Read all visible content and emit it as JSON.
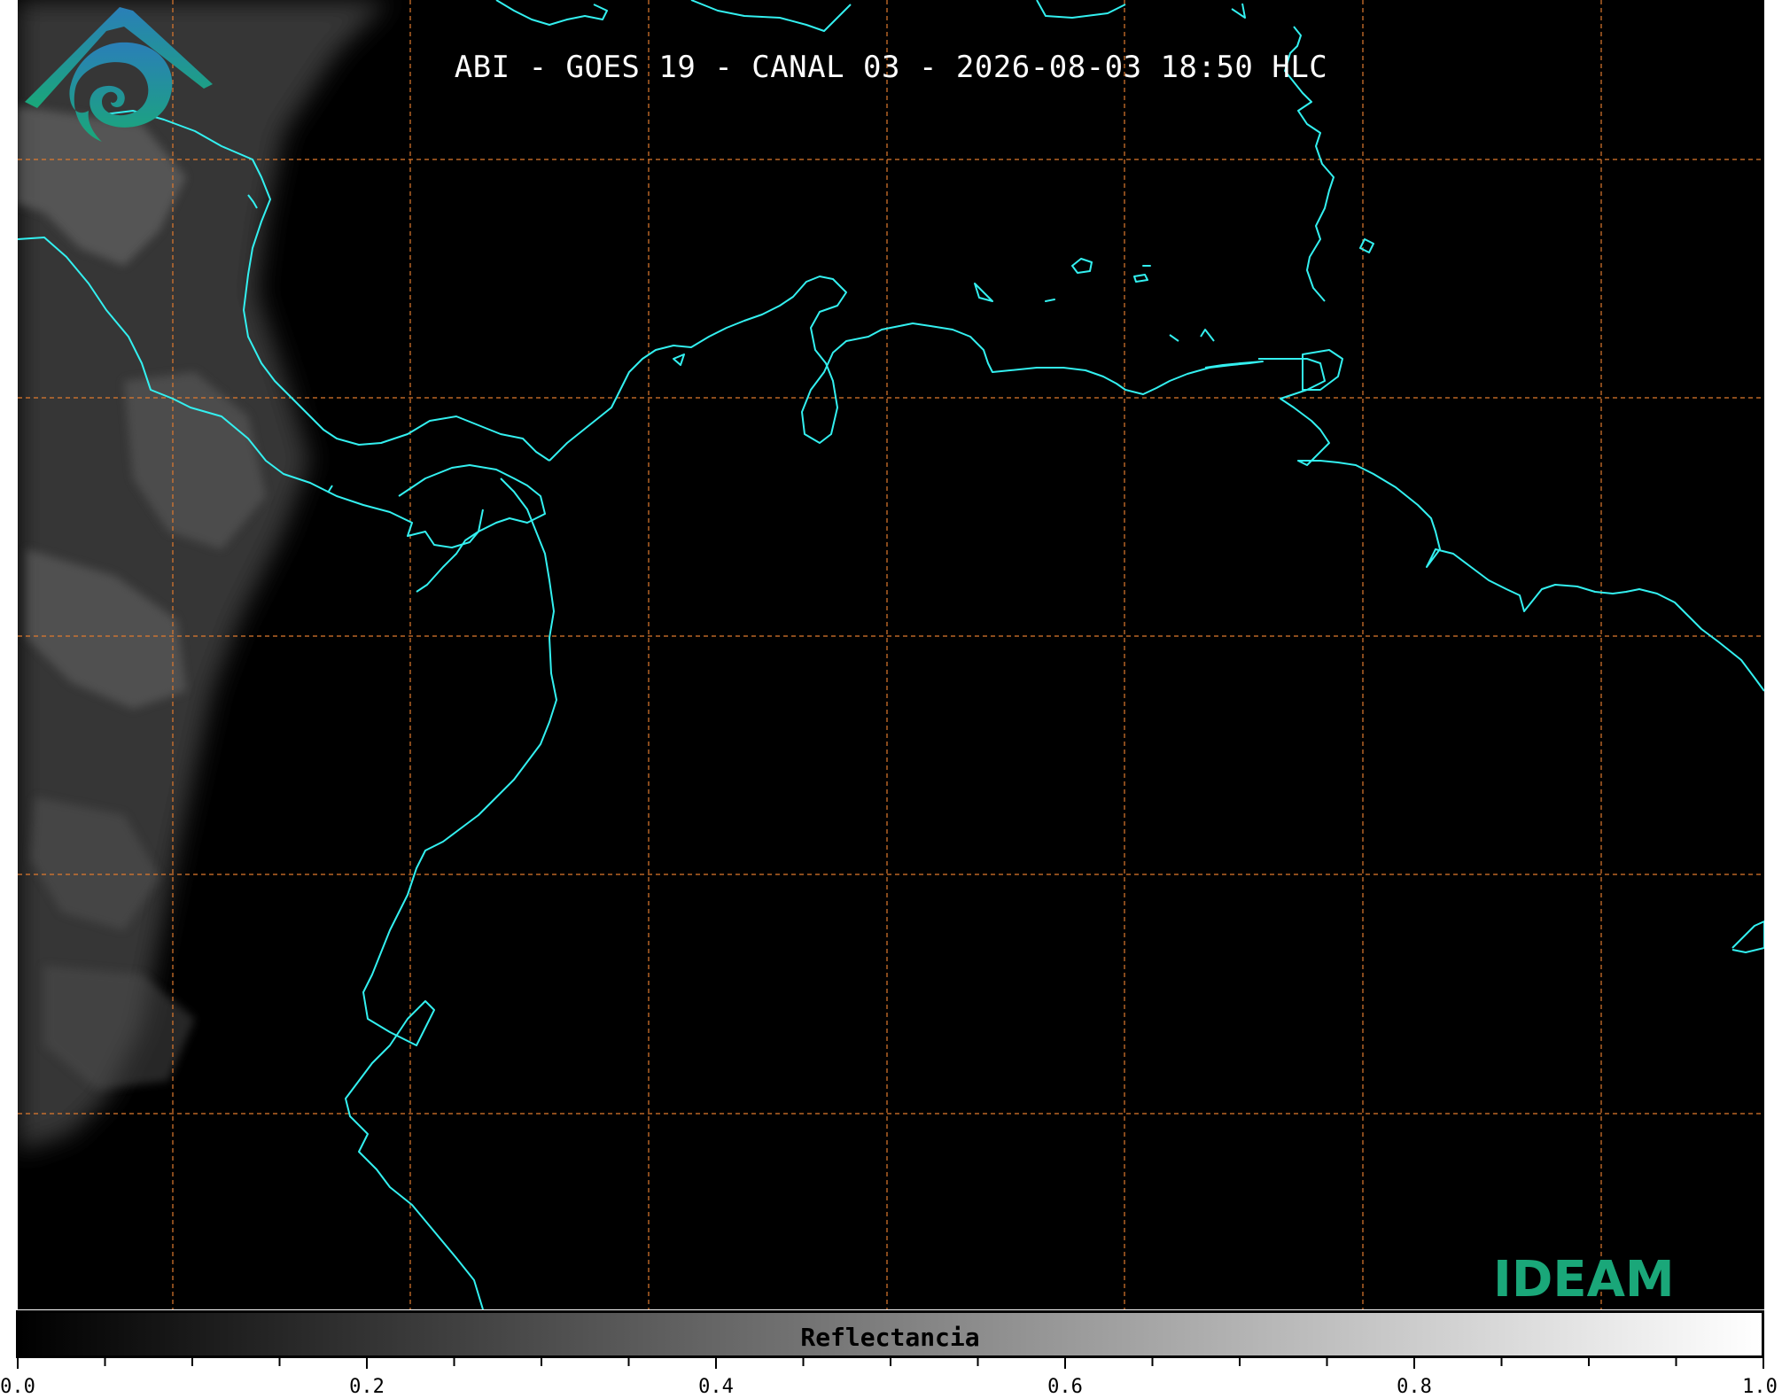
{
  "title": "ABI - GOES 19 - CANAL 03 - 2026-08-03 18:50 HLC",
  "colorbar": {
    "label": "Reflectancia",
    "min": 0.0,
    "max": 1.0,
    "tick_labels": [
      "0.0",
      "0.2",
      "0.4",
      "0.6",
      "0.8",
      "1.0"
    ],
    "minor_tick_step": 0.05,
    "gradient": [
      "#000000",
      "#ffffff"
    ]
  },
  "map": {
    "background_color": "#000000",
    "coastline_color": "#33f0f0",
    "gridline_color": "#e07a2e",
    "gridline_style": "dashed",
    "cloud_region": "left edge"
  },
  "logo": {
    "text": "IDEAM",
    "icon": "ideam-mountain-swirl-logo",
    "color": "#1aa779"
  }
}
